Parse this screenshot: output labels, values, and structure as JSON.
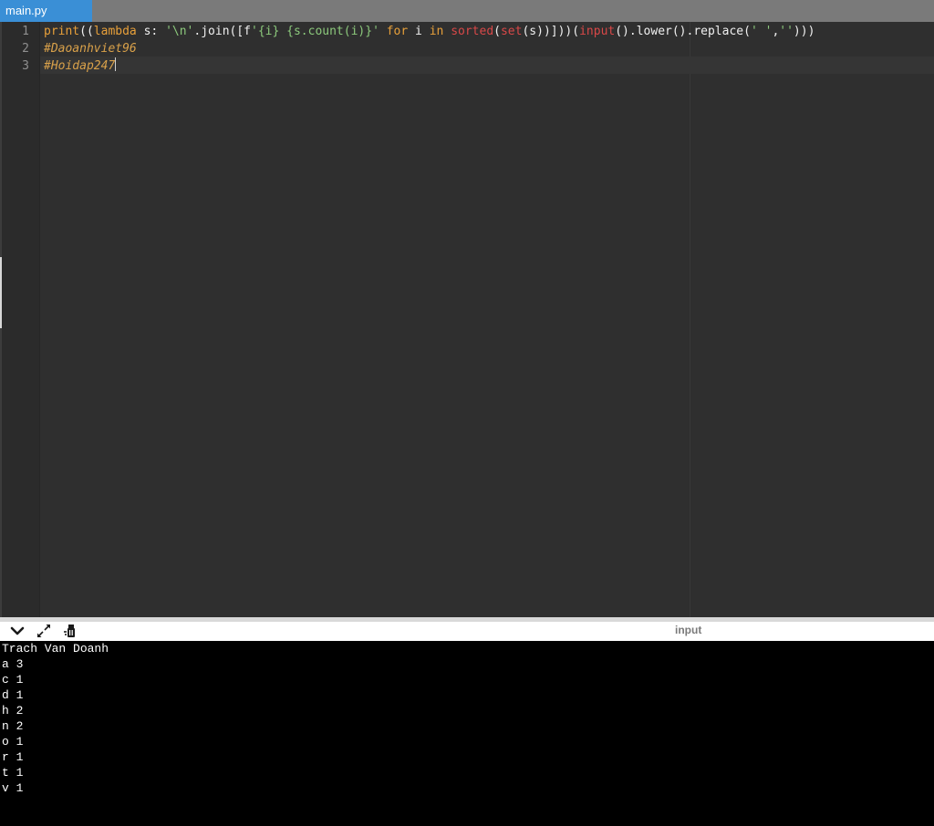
{
  "tab": {
    "filename": "main.py"
  },
  "editor": {
    "line_numbers": [
      "1",
      "2",
      "3"
    ],
    "line1": {
      "t1": "print",
      "t2": "((",
      "t3": "lambda",
      "t4": " s: ",
      "t5": "'\\n'",
      "t6": ".join([f",
      "t7": "'{i} {s.count(i)}'",
      "t8": " ",
      "t9": "for",
      "t10": " i ",
      "t11": "in",
      "t12": " ",
      "t13": "sorted",
      "t14": "(",
      "t15": "set",
      "t16": "(s))]))(",
      "t17": "input",
      "t18": "().lower().replace(",
      "t19": "' '",
      "t20": ",",
      "t21": "''",
      "t22": ")))"
    },
    "line2": "#Daoanhviet96",
    "line3": "#Hoidap247"
  },
  "console": {
    "title": "input",
    "toolbar": {
      "collapse_icon": "chevron-down-icon",
      "expand_icon": "expand-arrows-icon",
      "clear_icon": "clear-console-icon"
    },
    "lines": [
      "Trach Van Doanh",
      "a 3",
      "c 1",
      "d 1",
      "h 2",
      "n 2",
      "o 1",
      "r 1",
      "t 1",
      "v 1"
    ]
  },
  "colors": {
    "tab_active": "#3a8fd6",
    "tab_bar": "#7a7a7a",
    "editor_bg": "#2f2f2f",
    "gutter_bg": "#2b2b2b",
    "keyword": "#e8a03a",
    "string": "#8cc97c",
    "builtin": "#d94848",
    "comment": "#d9a14a",
    "console_bg": "#000000",
    "console_text": "#ffffff"
  }
}
